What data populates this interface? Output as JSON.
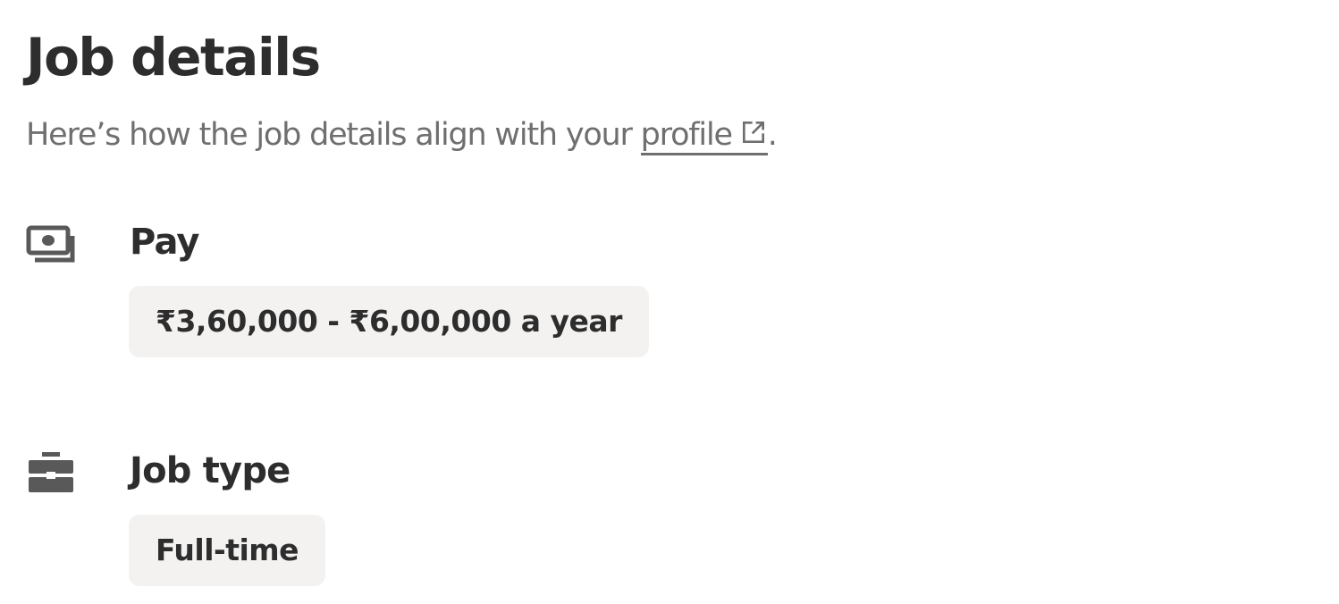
{
  "header": {
    "title": "Job details",
    "subtitle_prefix": "Here’s how the job details align with your ",
    "profile_link": "profile",
    "subtitle_suffix": "."
  },
  "sections": [
    {
      "label": "Pay",
      "icon": "money-icon",
      "values": [
        "₹3,60,000 - ₹6,00,000 a year"
      ]
    },
    {
      "label": "Job type",
      "icon": "briefcase-icon",
      "values": [
        "Full-time"
      ]
    }
  ],
  "colors": {
    "text_primary": "#2d2d2d",
    "text_secondary": "#6f6f6f",
    "pill_background": "#f3f2f1"
  }
}
